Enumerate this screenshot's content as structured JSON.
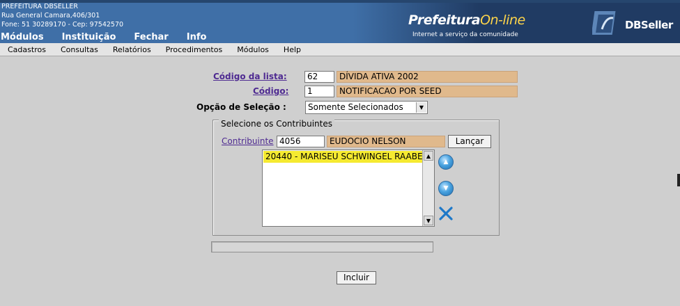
{
  "header": {
    "org_line1": "PREFEITURA DBSELLER",
    "org_line2": "Rua General Camara,406/301",
    "org_line3": "Fone: 51 30289170  -  Cep: 97542570",
    "brand_main": "Prefeitura",
    "brand_accent": "On-line",
    "brand_sub": "Internet a serviço da comunidade",
    "vendor": "DBSeller",
    "top_menu": [
      "Módulos",
      "Instituição",
      "Fechar",
      "Info"
    ]
  },
  "menubar": [
    "Cadastros",
    "Consultas",
    "Relatórios",
    "Procedimentos",
    "Módulos",
    "Help"
  ],
  "form": {
    "codigo_lista_label": "Código da lista:",
    "codigo_lista_value": "62",
    "codigo_lista_desc": "DÍVIDA ATIVA 2002",
    "codigo_label": "Código:",
    "codigo_value": "1",
    "codigo_desc": "NOTIFICACAO POR SEED",
    "opcao_label": "Opção de Seleção :",
    "opcao_value": "Somente Selecionados",
    "group_legend": "Selecione os Contribuintes",
    "contribuinte_label": "Contribuinte",
    "contribuinte_value": "4056",
    "contribuinte_name": "EUDOCIO NELSON",
    "lancar_label": "Lançar",
    "list_items": [
      "20440 - MARISEU SCHWINGEL RAABE"
    ],
    "incluir_label": "Incluir"
  },
  "colors": {
    "header_bg": "#3f6fa7",
    "readonly_field": "#e0b98c",
    "selected_item": "#f5ea30",
    "link": "#4e2a91"
  }
}
